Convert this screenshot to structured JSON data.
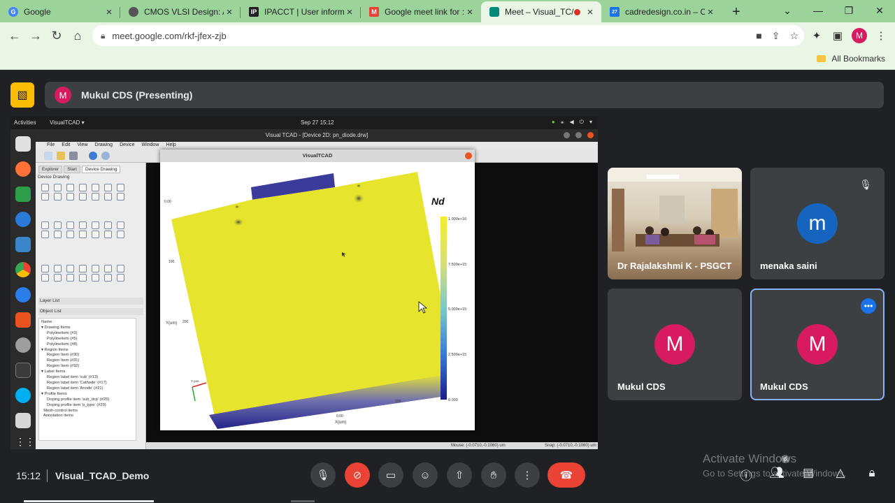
{
  "browser": {
    "tabs": [
      {
        "title": "Google",
        "favicon": "G",
        "color": "#4285f4"
      },
      {
        "title": "CMOS VLSI Design: A",
        "favicon": "",
        "color": "#555555"
      },
      {
        "title": "IPACCT | User informa",
        "favicon": "IP",
        "color": "#222222"
      },
      {
        "title": "Google meet link for :",
        "favicon": "M",
        "color": "#ea4335"
      },
      {
        "title": "Meet – Visual_TC/",
        "favicon": "",
        "color": "#00897b"
      },
      {
        "title": "cadredesign.co.in – Ca",
        "favicon": "27",
        "color": "#1a73e8"
      }
    ],
    "url": "meet.google.com/rkf-jfex-zjb",
    "bookmarks_label": "All Bookmarks",
    "profile_initial": "M"
  },
  "meet": {
    "presenter_initial": "M",
    "presenter_label": "Mukul CDS (Presenting)",
    "participants": [
      {
        "name": "Dr Rajalakshmi K - PSGCT",
        "initial": "",
        "color": "#8a6e52"
      },
      {
        "name": "menaka saini",
        "initial": "m",
        "color": "#1565c0"
      },
      {
        "name": "Mukul CDS",
        "initial": "M",
        "color": "#d81b60"
      },
      {
        "name": "Mukul CDS",
        "initial": "M",
        "color": "#d81b60"
      }
    ],
    "time": "15:12",
    "meeting_name": "Visual_TCAD_Demo",
    "people_count": "6"
  },
  "shared": {
    "activities": "Activities",
    "app_menu": "VisualTCAD ▾",
    "clock": "Sep 27  15:12",
    "window_title": "Visual TCAD - [Device 2D: pn_diode.drw]",
    "menu": [
      "File",
      "Edit",
      "View",
      "Drawing",
      "Device",
      "Window",
      "Help"
    ],
    "left_tabs": [
      "Explorer",
      "Start",
      "Device Drawing"
    ],
    "device_drawing_label": "Device Drawing",
    "layer_list": "Layer List",
    "object_list": "Object List",
    "tree": [
      "Name",
      "▾ Drawing Items",
      "     PolylineItem (#3)",
      "     PolylineItem (#5)",
      "     PolylineItem (#8)",
      "▾ Region Items",
      "     Region Item (#30)",
      "     Region Item (#31)",
      "     Region Item (#32)",
      "▾ Label Items",
      "     Region label item 'sub' (#13)",
      "     Region label item 'Cathode' (#17)",
      "     Region label item 'Anode' (#21)",
      "▾ Profile Items",
      "     Doping profile item 'sub_dcp' (#25)",
      "     Doping profile item 'p_type' (#29)",
      "  Mesh-control items",
      "  Annotation items"
    ],
    "status_mouse": "Mouse: (-0.0710,-0.1060) um",
    "status_snap": "Snap: (-0.0710,-0.1060) um",
    "plot_title": "VisualTCAD"
  },
  "plot": {
    "variable": "Nd",
    "colorbar_ticks": [
      "1.000e+16",
      "7.500e+15",
      "5.000e+15",
      "2.500e+15",
      "0.000"
    ],
    "xlabel": "X(um)",
    "ylabel": "Y(um)",
    "x_ticks": [
      "0.00",
      "100."
    ],
    "y_ticks": [
      "100.",
      "200.",
      "0.00"
    ],
    "axis_tag": "Y pos."
  },
  "watermark": {
    "line1": "Activate Windows",
    "line2": "Go to Settings to activate Windows."
  }
}
